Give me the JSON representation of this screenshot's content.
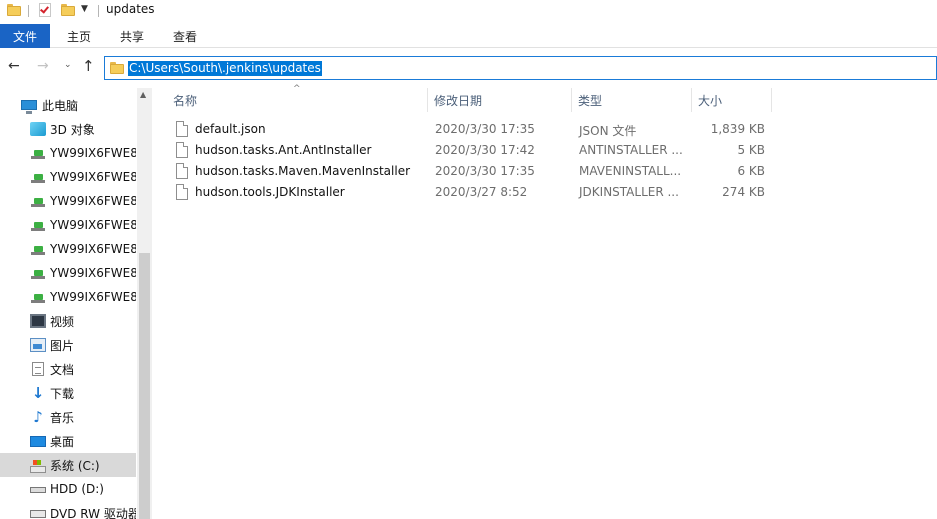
{
  "window": {
    "title": "updates"
  },
  "quick_access": {
    "icons": [
      "folder-icon",
      "properties-check-icon",
      "new-folder-icon",
      "customize-dropdown-icon"
    ]
  },
  "ribbon": {
    "file_tab": "文件",
    "tabs": [
      "主页",
      "共享",
      "查看"
    ]
  },
  "navigation": {
    "back": "←",
    "forward": "→",
    "recent": "⌄",
    "up": "↑"
  },
  "address": {
    "path": "C:\\Users\\South\\.jenkins\\updates"
  },
  "sidebar": {
    "items": [
      {
        "label": "此电脑",
        "icon": "computer-icon"
      },
      {
        "label": "3D 对象",
        "icon": "3d-objects-icon"
      },
      {
        "label": "YW99IX6FWE8",
        "icon": "network-drive-icon"
      },
      {
        "label": "YW99IX6FWE8",
        "icon": "network-drive-icon"
      },
      {
        "label": "YW99IX6FWE8",
        "icon": "network-drive-icon"
      },
      {
        "label": "YW99IX6FWE8",
        "icon": "network-drive-icon"
      },
      {
        "label": "YW99IX6FWE8",
        "icon": "network-drive-icon"
      },
      {
        "label": "YW99IX6FWE8",
        "icon": "network-drive-icon"
      },
      {
        "label": "YW99IX6FWE8",
        "icon": "network-drive-icon"
      },
      {
        "label": "视频",
        "icon": "videos-icon"
      },
      {
        "label": "图片",
        "icon": "pictures-icon"
      },
      {
        "label": "文档",
        "icon": "documents-icon"
      },
      {
        "label": "下载",
        "icon": "downloads-icon"
      },
      {
        "label": "音乐",
        "icon": "music-icon"
      },
      {
        "label": "桌面",
        "icon": "desktop-icon"
      },
      {
        "label": "系统 (C:)",
        "icon": "system-drive-icon",
        "selected": true
      },
      {
        "label": "HDD (D:)",
        "icon": "hdd-drive-icon"
      },
      {
        "label": "DVD RW 驱动器",
        "icon": "dvd-drive-icon"
      }
    ]
  },
  "columns": {
    "name": "名称",
    "date": "修改日期",
    "type": "类型",
    "size": "大小"
  },
  "files": [
    {
      "name": "default.json",
      "date": "2020/3/30 17:35",
      "type": "JSON 文件",
      "size": "1,839 KB"
    },
    {
      "name": "hudson.tasks.Ant.AntInstaller",
      "date": "2020/3/30 17:42",
      "type": "ANTINSTALLER ...",
      "size": "5 KB"
    },
    {
      "name": "hudson.tasks.Maven.MavenInstaller",
      "date": "2020/3/30 17:35",
      "type": "MAVENINSTALL...",
      "size": "6 KB"
    },
    {
      "name": "hudson.tools.JDKInstaller",
      "date": "2020/3/27 8:52",
      "type": "JDKINSTALLER ...",
      "size": "274 KB"
    }
  ],
  "colors": {
    "accent": "#1a64c5",
    "selection": "#0078d7",
    "header_text": "#4c607a"
  }
}
